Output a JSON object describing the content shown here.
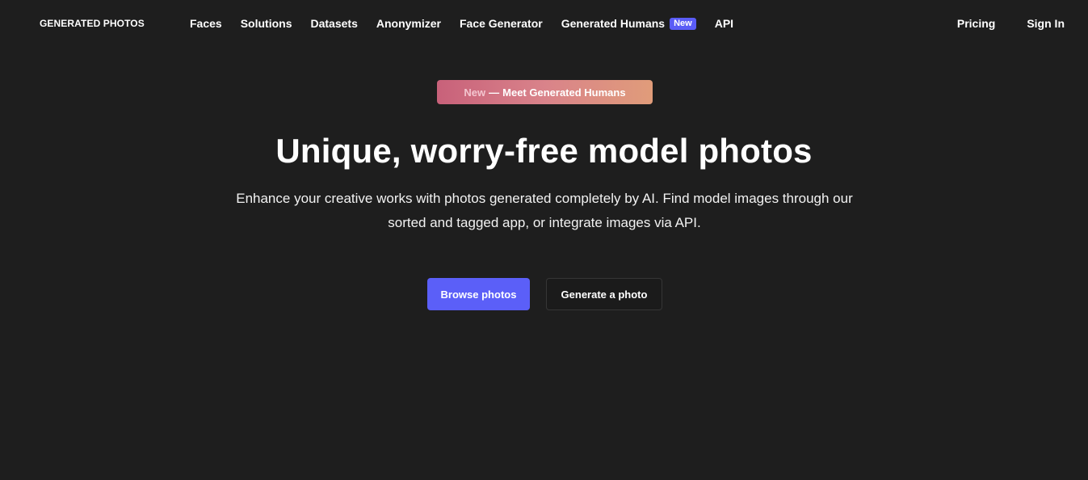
{
  "header": {
    "logo": "GENERATED PHOTOS",
    "nav": [
      {
        "label": "Faces"
      },
      {
        "label": "Solutions"
      },
      {
        "label": "Datasets"
      },
      {
        "label": "Anonymizer"
      },
      {
        "label": "Face Generator"
      },
      {
        "label": "Generated Humans",
        "badge": "New"
      },
      {
        "label": "API"
      }
    ],
    "right": {
      "pricing": "Pricing",
      "sign_in": "Sign In"
    }
  },
  "hero": {
    "announcement": {
      "tag": "New",
      "separator": "—",
      "text": "Meet Generated Humans"
    },
    "title": "Unique, worry-free model photos",
    "subtitle": "Enhance your creative works with photos generated completely by AI. Find model images through our sorted and tagged app, or integrate images via API.",
    "primary_button": "Browse photos",
    "secondary_button": "Generate a photo"
  },
  "colors": {
    "background": "#1e1e1e",
    "accent": "#5b5ff8",
    "badge": "#5a5cf6",
    "announce_gradient_start": "#c8617a",
    "announce_gradient_end": "#e09c7a"
  }
}
